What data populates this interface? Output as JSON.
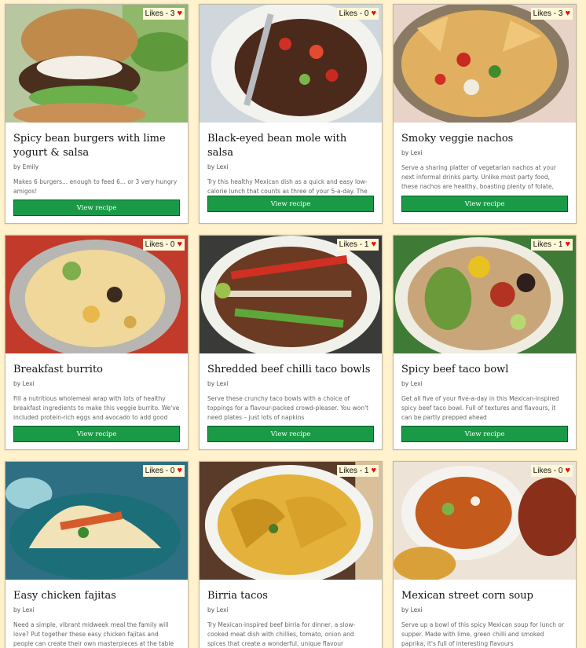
{
  "cards": [
    {
      "likes": "Likes - 3",
      "title": "Spicy bean burgers with lime yogurt & salsa",
      "author": "by Emily",
      "description": "Makes 6 burgers... enough to feed 6... or 3 very hungry amigos!",
      "button": "View recipe"
    },
    {
      "likes": "Likes - 0",
      "title": "Black-eyed bean mole with salsa",
      "author": "by Lexi",
      "description": "Try this healthy Mexican dish as a quick and easy low-calorie lunch that counts as three of your 5-a-day. The beans are a great source of protein and fibre",
      "button": "View recipe"
    },
    {
      "likes": "Likes - 3",
      "title": "Smoky veggie nachos",
      "author": "by Lexi",
      "description": "Serve a sharing platter of vegetarian nachos at your next informal drinks party. Unlike most party food, these nachos are healthy, boasting plenty of folate, fibre and vitamin c",
      "button": "View recipe"
    },
    {
      "likes": "Likes - 0",
      "title": "Breakfast burrito",
      "author": "by Lexi",
      "description": "Fill a nutritious wholemeal wrap with lots of healthy breakfast ingredients to make this veggie burrito. We've included protein-rich eggs and avocado to add good fats",
      "button": "View recipe"
    },
    {
      "likes": "Likes - 1",
      "title": "Shredded beef chilli taco bowls",
      "author": "by Lexi",
      "description": "Serve these crunchy taco bowls with a choice of toppings for a flavour-packed crowd-pleaser. You won't need plates – just lots of napkins",
      "button": "View recipe"
    },
    {
      "likes": "Likes - 1",
      "title": "Spicy beef taco bowl",
      "author": "by Lexi",
      "description": "Get all five of your five-a-day in this Mexican-inspired spicy beef taco bowl. Full of textures and flavours, it can be partly prepped ahead",
      "button": "View recipe"
    },
    {
      "likes": "Likes - 0",
      "title": "Easy chicken fajitas",
      "author": "by Lexi",
      "description": "Need a simple, vibrant midweek meal the family will love? Put together these easy chicken fajitas and people can create their own masterpieces at the table",
      "button": "View recipe"
    },
    {
      "likes": "Likes - 1",
      "title": "Birria tacos",
      "author": "by Lexi",
      "description": "Try Mexican-inspired beef birria for dinner, a slow-cooked meat dish with chillies, tomato, onion and spices that create a wonderful, unique flavour",
      "button": "View recipe"
    },
    {
      "likes": "Likes - 0",
      "title": "Mexican street corn soup",
      "author": "by Lexi",
      "description": "Serve up a bowl of this spicy Mexican soup for lunch or supper. Made with lime, green chilli and smoked paprika, it's full of interesting flavours",
      "button": "View recipe"
    }
  ],
  "colors": {
    "page_background": "#fff2cc",
    "button": "#1a9a46",
    "heart": "#e01010"
  },
  "icons": {
    "like": "heart-icon"
  }
}
